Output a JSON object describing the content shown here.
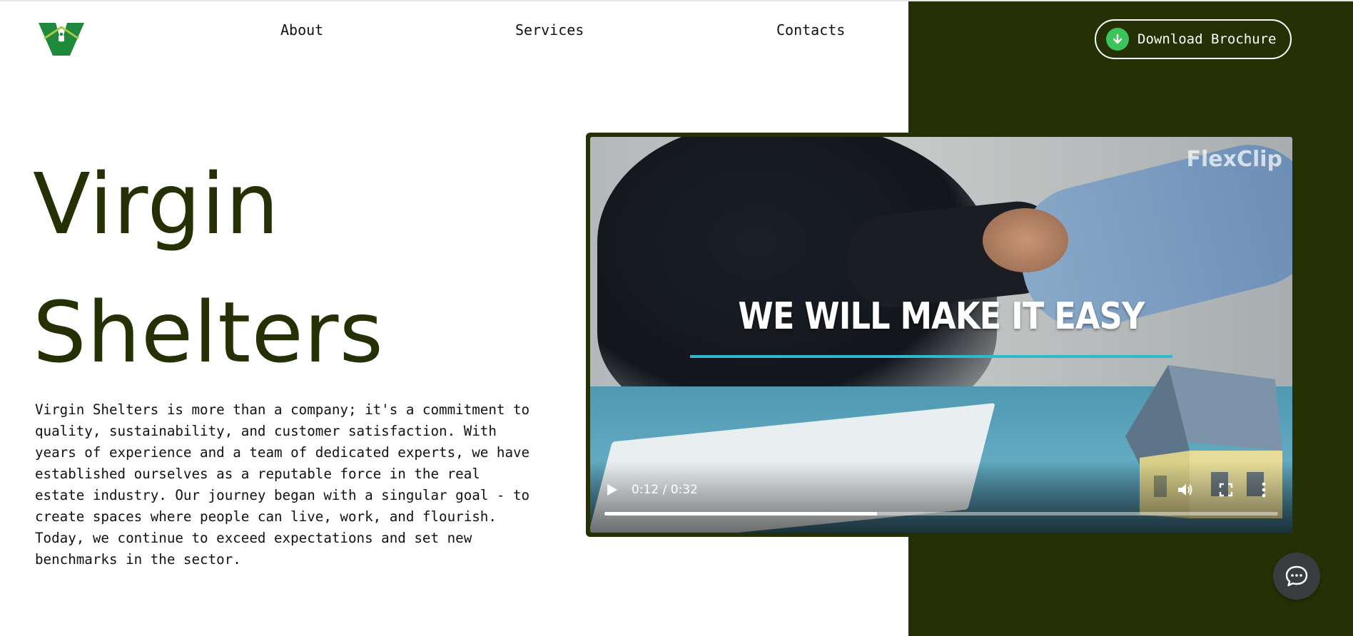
{
  "brand": {
    "logo_icon": "virgin-shelters-logo-icon",
    "logo_colors": [
      "#1f8a3b",
      "#9fc23c"
    ]
  },
  "nav": {
    "items": [
      {
        "label": "About"
      },
      {
        "label": "Services"
      },
      {
        "label": "Contacts"
      }
    ]
  },
  "cta": {
    "label": "Download Brochure",
    "icon": "download-arrow-icon",
    "icon_color": "#3cc45a"
  },
  "hero": {
    "title_line1": "Virgin",
    "title_line2": "Shelters",
    "description": "Virgin Shelters is more than a company; it's a commitment to quality, sustainability, and customer satisfaction. With years of experience and a team of dedicated experts, we have established ourselves as a reputable force in the real estate industry. Our journey began with a singular goal - to create spaces where people can live, work, and flourish. Today, we continue to exceed expectations and set new benchmarks in the sector."
  },
  "video": {
    "overlay_text": "WE WILL MAKE IT EASY",
    "watermark": "FlexClip",
    "time_display": "0:12 / 0:32",
    "progress_fraction": 0.405,
    "controls": [
      "play-icon",
      "volume-icon",
      "fullscreen-icon",
      "more-vertical-icon"
    ]
  },
  "chat": {
    "icon": "chat-bubble-icon"
  },
  "colors": {
    "brand_dark_green": "#253104",
    "accent_green": "#3cc45a",
    "video_accent": "#2fb8d0"
  }
}
